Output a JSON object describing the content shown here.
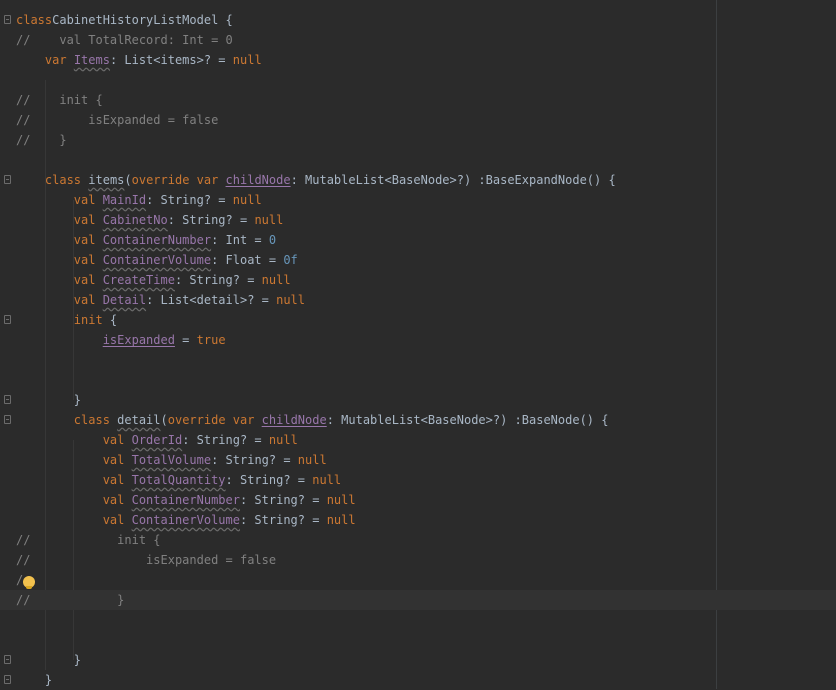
{
  "editor": {
    "lines": [
      {
        "id": "l1",
        "indent": "",
        "parts": [
          [
            "kw",
            "class"
          ],
          [
            "",
            "CabinetHistoryListModel {"
          ]
        ]
      },
      {
        "id": "l2",
        "indent": "",
        "parts": [
          [
            "cm",
            "//    val TotalRecord: Int = 0"
          ]
        ]
      },
      {
        "id": "l3",
        "indent": "    ",
        "parts": [
          [
            "kw",
            "var "
          ],
          [
            "prop",
            "Items"
          ],
          [
            "",
            ": List<items>? = "
          ],
          [
            "kw",
            "null"
          ]
        ]
      },
      {
        "id": "l4",
        "indent": "",
        "parts": []
      },
      {
        "id": "l5",
        "indent": "",
        "parts": [
          [
            "cm",
            "//    init {"
          ]
        ]
      },
      {
        "id": "l6",
        "indent": "",
        "parts": [
          [
            "cm",
            "//        isExpanded = false"
          ]
        ]
      },
      {
        "id": "l7",
        "indent": "",
        "parts": [
          [
            "cm",
            "//    }"
          ]
        ]
      },
      {
        "id": "l8",
        "indent": "",
        "parts": []
      },
      {
        "id": "l9",
        "indent": "    ",
        "parts": [
          [
            "kw",
            "class "
          ],
          [
            "fn",
            "items"
          ],
          [
            "",
            "("
          ],
          [
            "kw",
            "override var "
          ],
          [
            "propu",
            "childNode"
          ],
          [
            "",
            ": MutableList<BaseNode>?) :BaseExpandNode() {"
          ]
        ]
      },
      {
        "id": "l10",
        "indent": "        ",
        "parts": [
          [
            "kw",
            "val "
          ],
          [
            "prop",
            "MainId"
          ],
          [
            "",
            ": String? = "
          ],
          [
            "kw",
            "null"
          ]
        ]
      },
      {
        "id": "l11",
        "indent": "        ",
        "parts": [
          [
            "kw",
            "val "
          ],
          [
            "prop",
            "CabinetNo"
          ],
          [
            "",
            ": String? = "
          ],
          [
            "kw",
            "null"
          ]
        ]
      },
      {
        "id": "l12",
        "indent": "        ",
        "parts": [
          [
            "kw",
            "val "
          ],
          [
            "prop",
            "ContainerNumber"
          ],
          [
            "",
            ": Int = "
          ],
          [
            "num",
            "0"
          ]
        ]
      },
      {
        "id": "l13",
        "indent": "        ",
        "parts": [
          [
            "kw",
            "val "
          ],
          [
            "prop",
            "ContainerVolume"
          ],
          [
            "",
            ": Float = "
          ],
          [
            "num",
            "0f"
          ]
        ]
      },
      {
        "id": "l14",
        "indent": "        ",
        "parts": [
          [
            "kw",
            "val "
          ],
          [
            "prop",
            "CreateTime"
          ],
          [
            "",
            ": String? = "
          ],
          [
            "kw",
            "null"
          ]
        ]
      },
      {
        "id": "l15",
        "indent": "        ",
        "parts": [
          [
            "kw",
            "val "
          ],
          [
            "prop",
            "Detail"
          ],
          [
            "",
            ": List<detail>? = "
          ],
          [
            "kw",
            "null"
          ]
        ]
      },
      {
        "id": "l16",
        "indent": "        ",
        "parts": [
          [
            "kw",
            "init "
          ],
          [
            "",
            "{"
          ]
        ]
      },
      {
        "id": "l17",
        "indent": "            ",
        "parts": [
          [
            "propu",
            "isExpanded"
          ],
          [
            "",
            " = "
          ],
          [
            "kw",
            "true"
          ]
        ]
      },
      {
        "id": "l18",
        "indent": "",
        "parts": []
      },
      {
        "id": "l19",
        "indent": "",
        "parts": []
      },
      {
        "id": "l20",
        "indent": "        ",
        "parts": [
          [
            "",
            "}"
          ]
        ]
      },
      {
        "id": "l21",
        "indent": "        ",
        "parts": [
          [
            "kw",
            "class "
          ],
          [
            "fn",
            "detail"
          ],
          [
            "",
            "("
          ],
          [
            "kw",
            "override var "
          ],
          [
            "propu",
            "childNode"
          ],
          [
            "",
            ": MutableList<BaseNode>?) :BaseNode() {"
          ]
        ]
      },
      {
        "id": "l22",
        "indent": "            ",
        "parts": [
          [
            "kw",
            "val "
          ],
          [
            "prop",
            "OrderId"
          ],
          [
            "",
            ": String? = "
          ],
          [
            "kw",
            "null"
          ]
        ]
      },
      {
        "id": "l23",
        "indent": "            ",
        "parts": [
          [
            "kw",
            "val "
          ],
          [
            "prop",
            "TotalVolume"
          ],
          [
            "",
            ": String? = "
          ],
          [
            "kw",
            "null"
          ]
        ]
      },
      {
        "id": "l24",
        "indent": "            ",
        "parts": [
          [
            "kw",
            "val "
          ],
          [
            "prop",
            "TotalQuantity"
          ],
          [
            "",
            ": String? = "
          ],
          [
            "kw",
            "null"
          ]
        ]
      },
      {
        "id": "l25",
        "indent": "            ",
        "parts": [
          [
            "kw",
            "val "
          ],
          [
            "prop",
            "ContainerNumber"
          ],
          [
            "",
            ": String? = "
          ],
          [
            "kw",
            "null"
          ]
        ]
      },
      {
        "id": "l26",
        "indent": "            ",
        "parts": [
          [
            "kw",
            "val "
          ],
          [
            "prop",
            "ContainerVolume"
          ],
          [
            "",
            ": String? = "
          ],
          [
            "kw",
            "null"
          ]
        ]
      },
      {
        "id": "l27",
        "indent": "",
        "parts": [
          [
            "cm",
            "//            init {"
          ]
        ]
      },
      {
        "id": "l28",
        "indent": "",
        "parts": [
          [
            "cm",
            "//                isExpanded = false"
          ]
        ]
      },
      {
        "id": "l29",
        "indent": "",
        "parts": [
          [
            "cm",
            "/"
          ]
        ]
      },
      {
        "id": "l30",
        "indent": "",
        "parts": [
          [
            "cm",
            "//            }"
          ]
        ]
      },
      {
        "id": "l31",
        "indent": "",
        "parts": []
      },
      {
        "id": "l32",
        "indent": "",
        "parts": []
      },
      {
        "id": "l33",
        "indent": "        ",
        "parts": [
          [
            "",
            "}"
          ]
        ]
      },
      {
        "id": "l34",
        "indent": "    ",
        "parts": [
          [
            "",
            "}"
          ]
        ]
      }
    ],
    "current_line": "l30",
    "icons": {
      "intention": "lightbulb-icon",
      "fold": "fold-marker-icon"
    },
    "colors": {
      "background": "#2b2b2b",
      "keyword": "#cc7832",
      "property": "#9876aa",
      "number": "#6897bb",
      "comment": "#808080",
      "text": "#a9b7c6",
      "bulb": "#f2c14e"
    }
  }
}
